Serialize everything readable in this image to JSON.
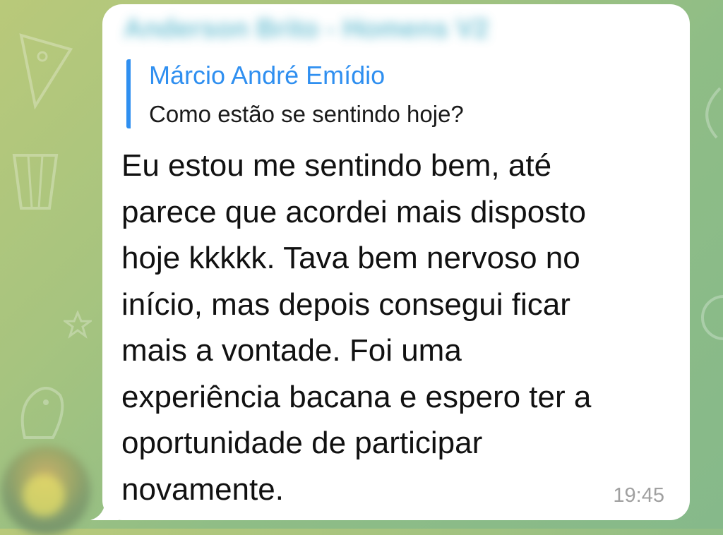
{
  "chat": {
    "sender_name": "Anderson Brito - Homens V2",
    "reply": {
      "author": "Márcio André Emídio",
      "text": "Como estão se sentindo hoje?"
    },
    "message": {
      "text": "Eu estou me sentindo bem, até\nparece que acordei mais disposto\nhoje kkkkk. Tava bem nervoso no\ninício,  mas depois consegui ficar\nmais a vontade.  Foi uma\nexperiência bacana e espero ter a\noportunidade de participar\nnovamente.",
      "time": "19:45"
    }
  },
  "colors": {
    "reply_accent": "#2f8ff0",
    "bubble": "#ffffff",
    "wallpaper": "#9fc47f"
  }
}
